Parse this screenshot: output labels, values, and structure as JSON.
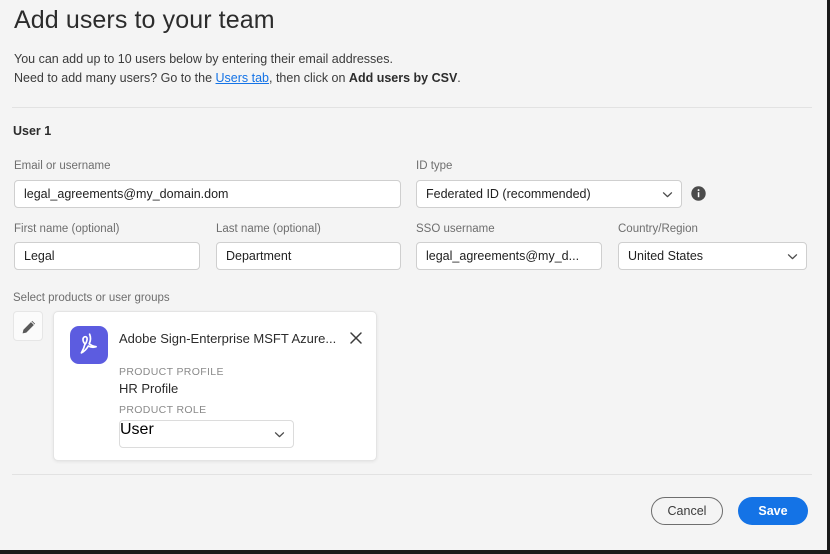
{
  "page": {
    "title": "Add users to your team",
    "intro_line1": "You can add up to 10 users below by entering their email addresses.",
    "intro_line2_pre": "Need to add many users? Go to the ",
    "intro_link": "Users tab",
    "intro_line2_mid": ", then click on ",
    "intro_line2_bold": "Add users by CSV",
    "intro_line2_end": ".",
    "link_color": "#1473e6"
  },
  "user_section": {
    "heading": "User 1",
    "email": {
      "label": "Email or username",
      "value": "legal_agreements@my_domain.dom"
    },
    "id_type": {
      "label": "ID type",
      "value": "Federated ID (recommended)"
    },
    "info_icon": "info-icon",
    "first_name": {
      "label": "First name (optional)",
      "value": "Legal"
    },
    "last_name": {
      "label": "Last name (optional)",
      "value": "Department"
    },
    "sso_username": {
      "label": "SSO username",
      "value": "legal_agreements@my_d..."
    },
    "country": {
      "label": "Country/Region",
      "value": "United States"
    }
  },
  "products": {
    "label": "Select products or user groups",
    "edit_icon": "pencil-icon",
    "card": {
      "app_icon": "adobe-acrobat-icon",
      "app_icon_color": "#5c5ce0",
      "name": "Adobe Sign-Enterprise MSFT Azure...",
      "close_icon": "close-icon",
      "profile_label": "PRODUCT PROFILE",
      "profile_value": "HR Profile",
      "role_label": "PRODUCT ROLE",
      "role_value": "User"
    }
  },
  "footer": {
    "cancel_label": "Cancel",
    "save_label": "Save",
    "save_color": "#1473e6"
  }
}
